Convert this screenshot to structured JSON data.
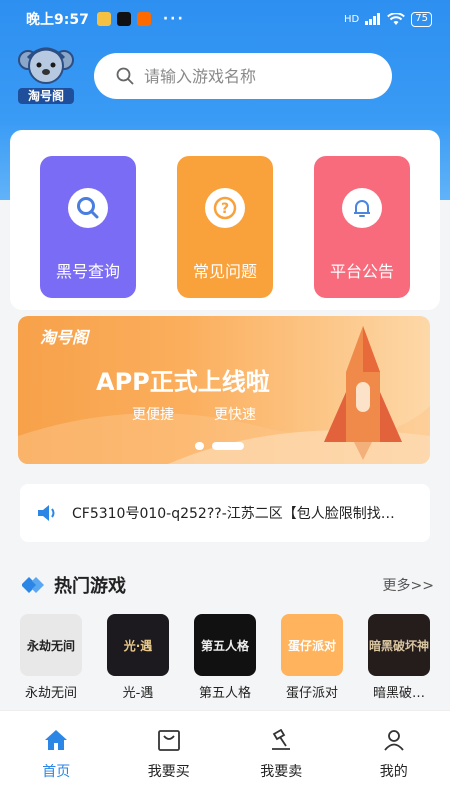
{
  "status_bar": {
    "time": "晚上9:57",
    "signal": "HD",
    "battery": "75"
  },
  "header": {
    "logo_text": "淘号阁",
    "search_placeholder": "请输入游戏名称"
  },
  "quick_actions": [
    {
      "label": "黑号查询",
      "icon": "search-icon",
      "color": "#7b6cf6"
    },
    {
      "label": "常见问题",
      "icon": "question-icon",
      "color": "#f9a13a"
    },
    {
      "label": "平台公告",
      "icon": "bell-icon",
      "color": "#f76b7c"
    }
  ],
  "banner": {
    "brand": "淘号阁",
    "title": "APP正式上线啦",
    "sub_left": "更便捷",
    "sub_right": "更快速",
    "active_slide": 2,
    "slide_count": 2
  },
  "notice": {
    "text": "CF5310号010-q252??-江苏二区【包人脸限制找…"
  },
  "hot_games": {
    "title": "热门游戏",
    "more": "更多>>",
    "items": [
      {
        "name": "永劫无间",
        "thumb_text": "永劫无间",
        "bg": "#e8e8e8",
        "fg": "#222"
      },
      {
        "name": "光-遇",
        "thumb_text": "光·遇",
        "bg": "#1d1a1f",
        "fg": "#e8c98a"
      },
      {
        "name": "第五人格",
        "thumb_text": "第五人格",
        "bg": "#111",
        "fg": "#eee"
      },
      {
        "name": "蛋仔派对",
        "thumb_text": "蛋仔派对",
        "bg": "#ffb35c",
        "fg": "#fff"
      },
      {
        "name": "暗黑破…",
        "thumb_text": "暗黑破坏神",
        "bg": "#241d1c",
        "fg": "#d9c4a0"
      }
    ]
  },
  "tab_bar": {
    "items": [
      {
        "label": "首页",
        "icon": "home-icon",
        "active": true
      },
      {
        "label": "我要买",
        "icon": "shopping-bag-icon",
        "active": false
      },
      {
        "label": "我要卖",
        "icon": "hammer-icon",
        "active": false
      },
      {
        "label": "我的",
        "icon": "user-icon",
        "active": false
      }
    ]
  }
}
